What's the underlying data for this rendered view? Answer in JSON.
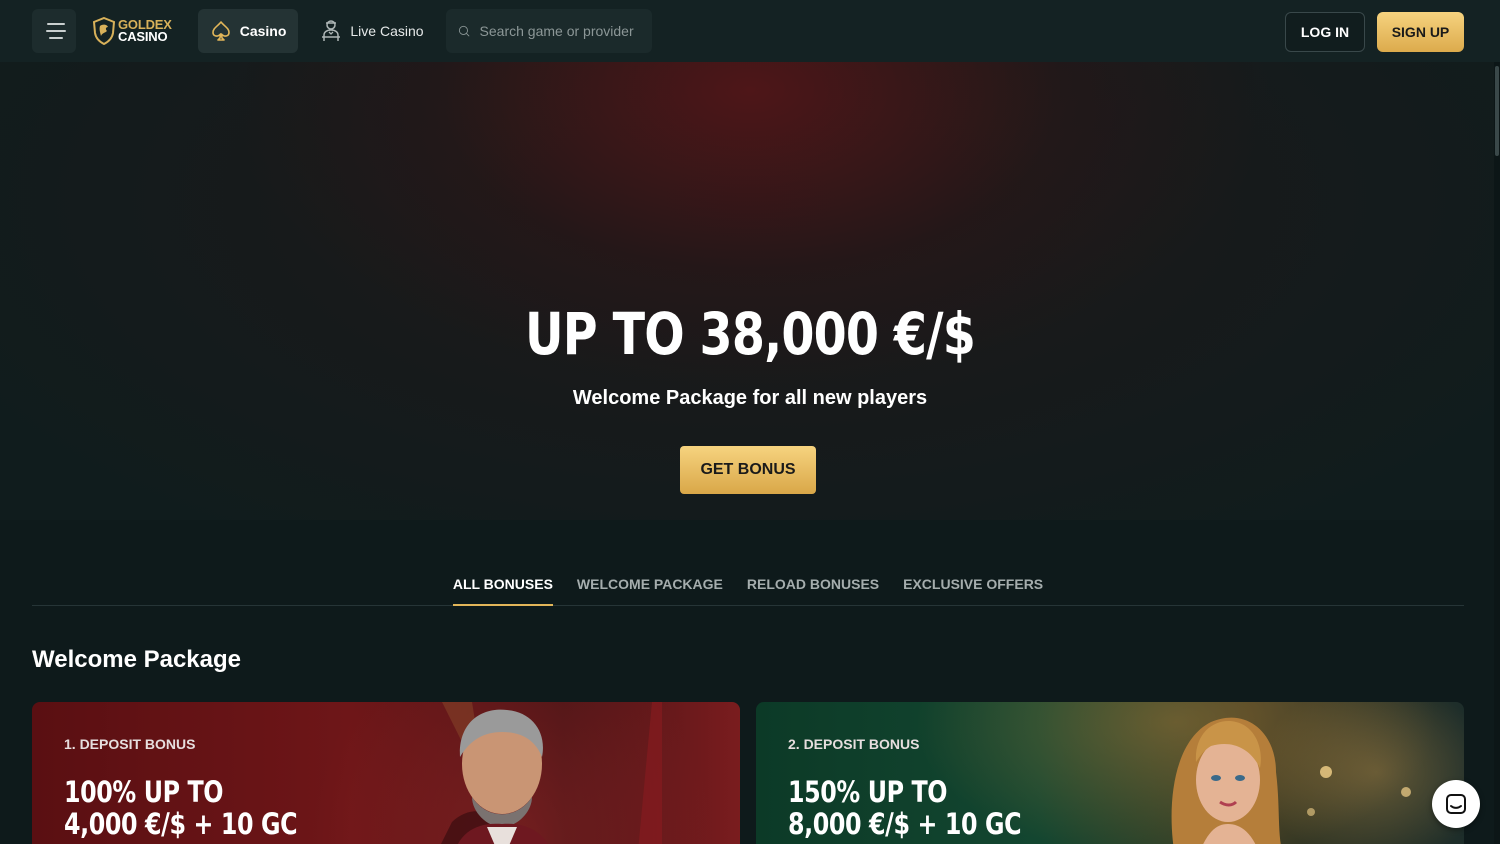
{
  "header": {
    "logo_line1": "GOLDEX",
    "logo_line2": "CASINO",
    "nav": [
      {
        "label": "Casino",
        "icon": "spade-icon",
        "active": true
      },
      {
        "label": "Live Casino",
        "icon": "dealer-icon",
        "active": false
      }
    ],
    "search_placeholder": "Search game or provider",
    "login_label": "LOG IN",
    "signup_label": "SIGN UP"
  },
  "hero": {
    "title": "UP TO 38,000 €/$",
    "subtitle": "Welcome Package for all new players",
    "cta_label": "GET BONUS"
  },
  "tabs": [
    {
      "label": "ALL BONUSES",
      "active": true
    },
    {
      "label": "WELCOME PACKAGE",
      "active": false
    },
    {
      "label": "RELOAD BONUSES",
      "active": false
    },
    {
      "label": "EXCLUSIVE OFFERS",
      "active": false
    }
  ],
  "section": {
    "title": "Welcome Package"
  },
  "cards": [
    {
      "label": "1. DEPOSIT BONUS",
      "amount_line1": "100% UP TO",
      "amount_line2": "4,000 €/$ + 10 GC"
    },
    {
      "label": "2. DEPOSIT BONUS",
      "amount_line1": "150% UP TO",
      "amount_line2": "8,000 €/$ + 10 GC"
    }
  ],
  "colors": {
    "accent_gold": "#e2b659",
    "background": "#0f1c1d",
    "header": "#142223"
  }
}
